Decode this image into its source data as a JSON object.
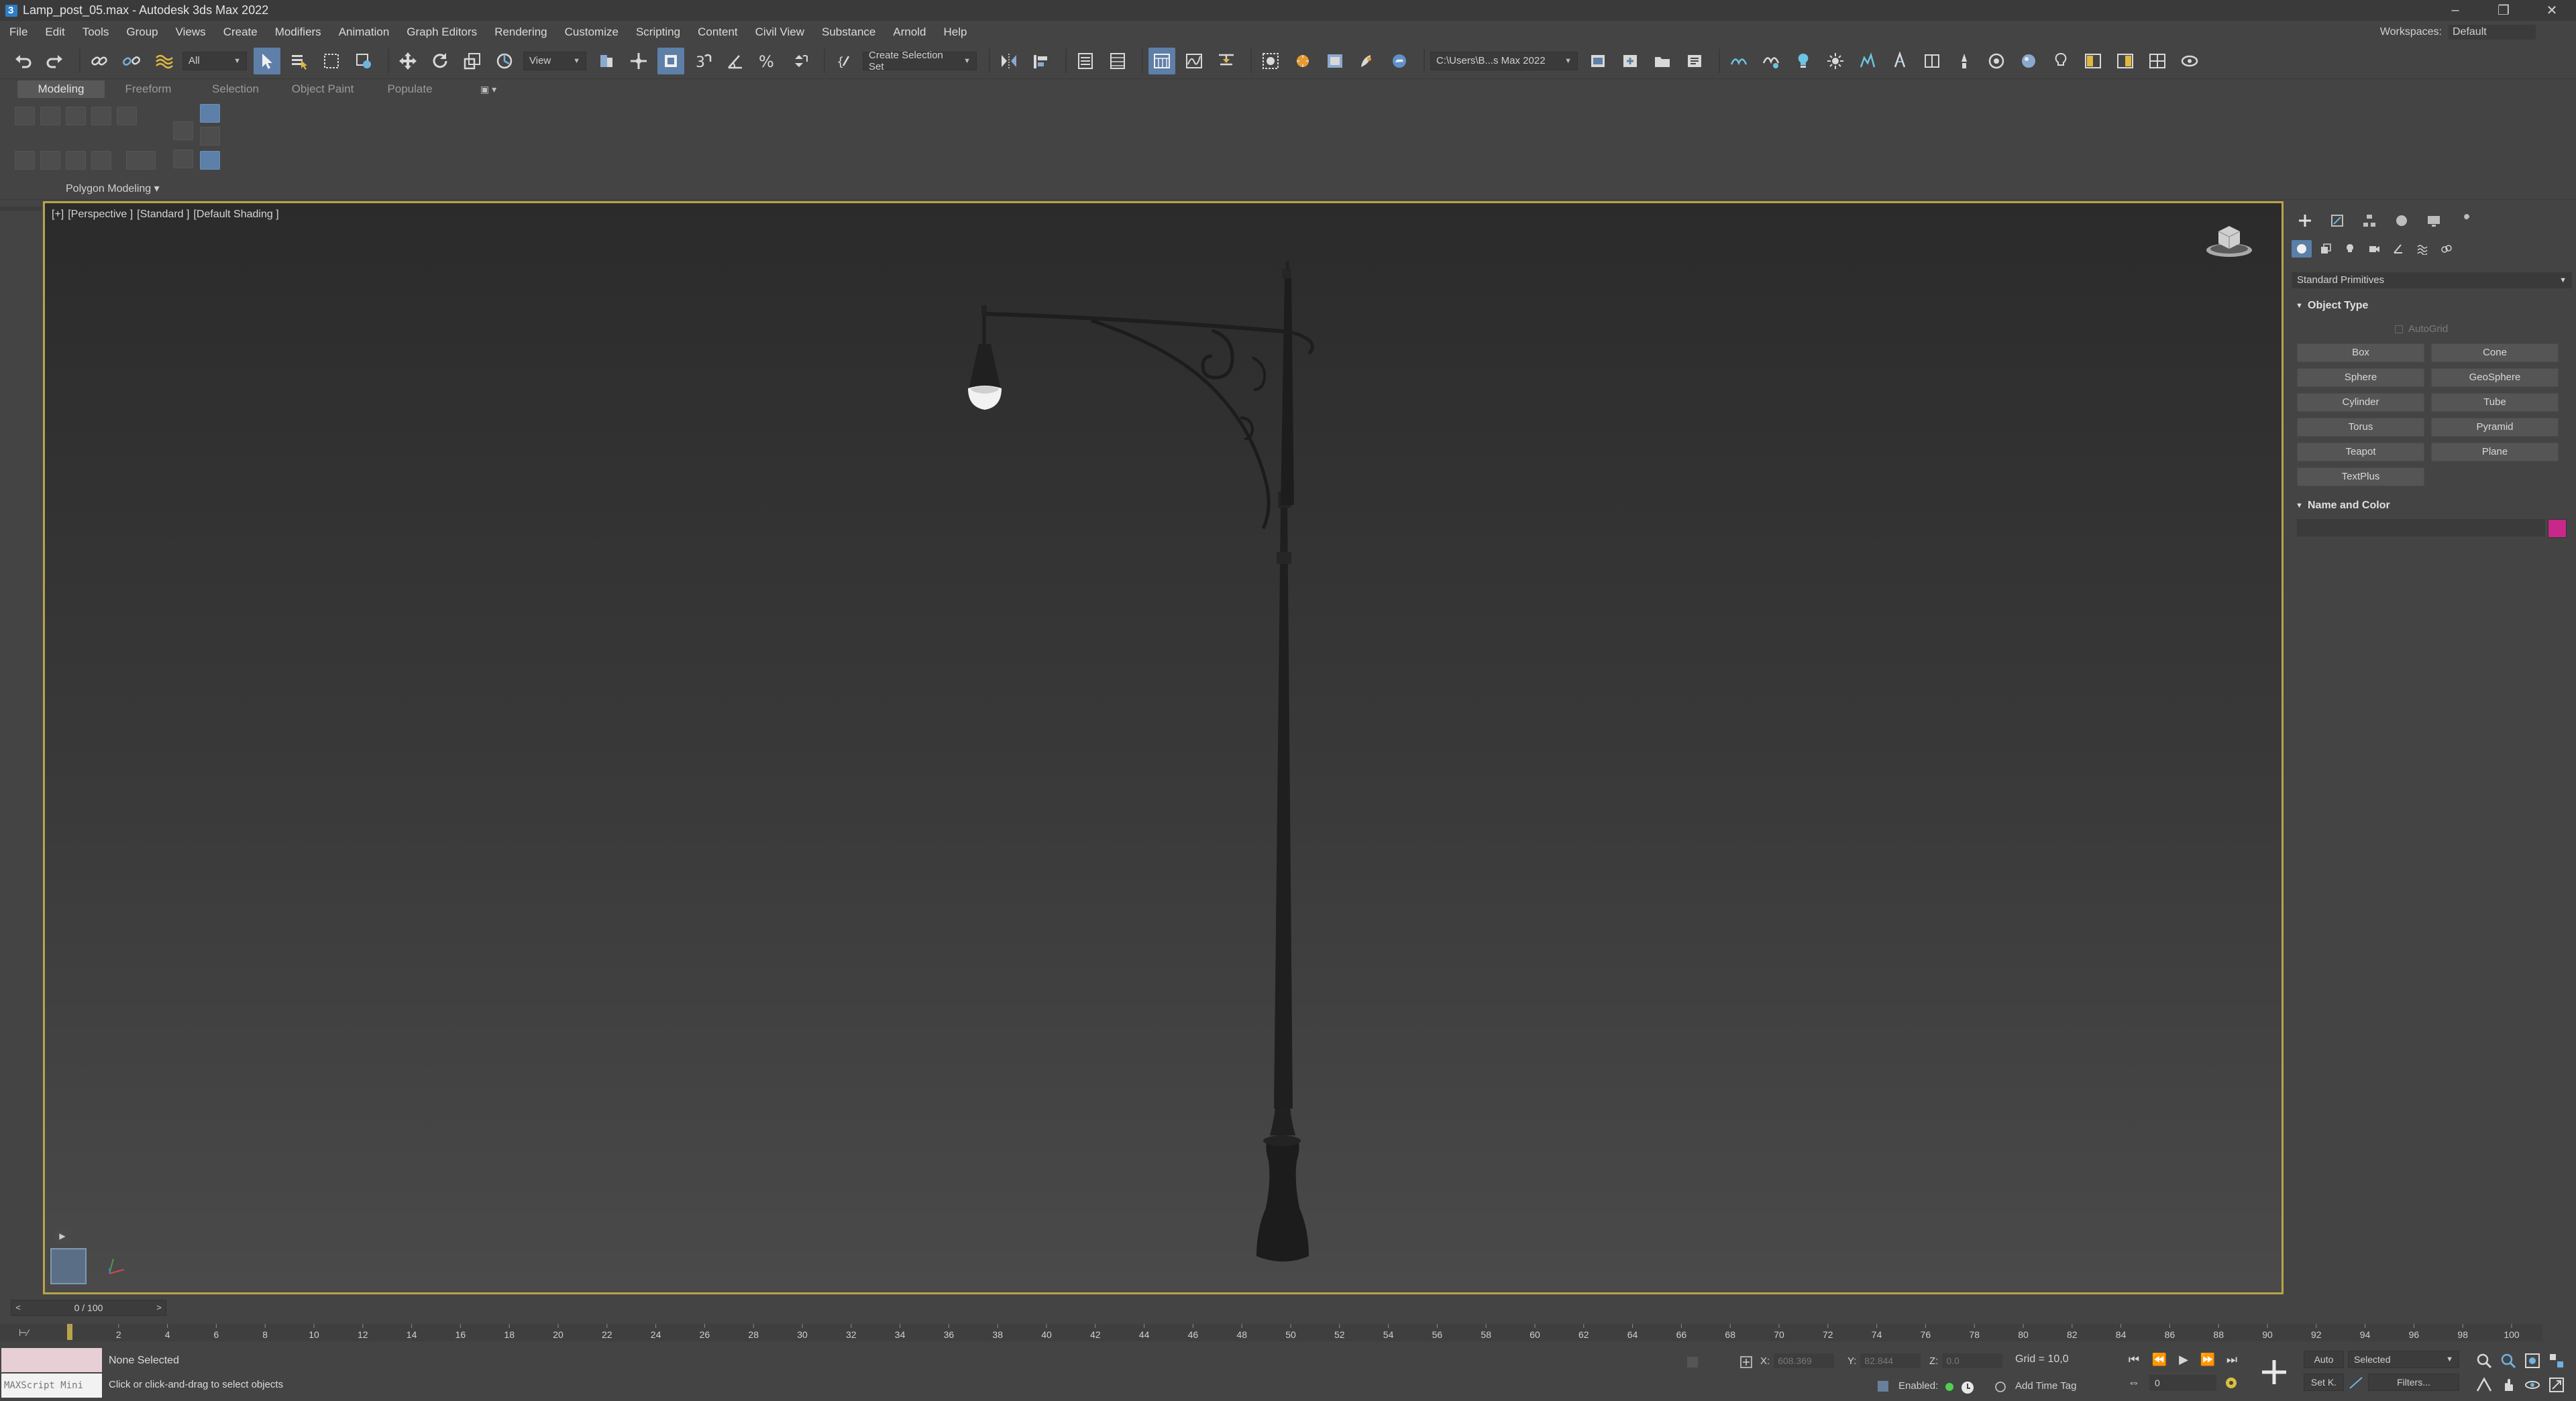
{
  "window": {
    "title": "Lamp_post_05.max - Autodesk 3ds Max 2022",
    "controls": [
      "–",
      "❐",
      "✕"
    ]
  },
  "menu": {
    "items": [
      "File",
      "Edit",
      "Tools",
      "Group",
      "Views",
      "Create",
      "Modifiers",
      "Animation",
      "Graph Editors",
      "Rendering",
      "Customize",
      "Scripting",
      "Content",
      "Civil View",
      "Substance",
      "Arnold",
      "Help"
    ],
    "workspaces_label": "Workspaces:",
    "workspaces_value": "Default"
  },
  "toolbar": {
    "filter_value": "All",
    "ref_coord_value": "View",
    "selection_set_placeholder": "Create Selection Set",
    "project_path": "C:\\Users\\B...s Max 2022"
  },
  "ribbon": {
    "tabs": [
      "Modeling",
      "Freeform",
      "Selection",
      "Object Paint",
      "Populate"
    ],
    "active_tab": "Modeling",
    "group_label": "Polygon Modeling"
  },
  "viewport": {
    "label_parts": [
      "[+]",
      "[Perspective ]",
      "[Standard ]",
      "[Default Shading ]"
    ]
  },
  "command_panel": {
    "category": "Standard Primitives",
    "object_type_title": "Object Type",
    "autogrid_label": "AutoGrid",
    "primitives": [
      "Box",
      "Cone",
      "Sphere",
      "GeoSphere",
      "Cylinder",
      "Tube",
      "Torus",
      "Pyramid",
      "Teapot",
      "Plane",
      "TextPlus"
    ],
    "name_color_title": "Name and Color",
    "object_color": "#c8288a"
  },
  "timeline": {
    "frame_readout": "0 / 100",
    "ticks": [
      "0",
      "2",
      "4",
      "6",
      "8",
      "10",
      "12",
      "14",
      "16",
      "18",
      "20",
      "22",
      "24",
      "26",
      "28",
      "30",
      "32",
      "34",
      "36",
      "38",
      "40",
      "42",
      "44",
      "46",
      "48",
      "50",
      "52",
      "54",
      "56",
      "58",
      "60",
      "62",
      "64",
      "66",
      "68",
      "70",
      "72",
      "74",
      "76",
      "78",
      "80",
      "82",
      "84",
      "86",
      "88",
      "90",
      "92",
      "94",
      "96",
      "98",
      "100"
    ]
  },
  "status": {
    "maxscript_label": "MAXScript Mini",
    "selection_msg": "None Selected",
    "prompt_msg": "Click or click-and-drag to select objects",
    "x_label": "X:",
    "x_value": "608.369",
    "y_label": "Y:",
    "y_value": "82.844",
    "z_label": "Z:",
    "z_value": "0.0",
    "grid": "Grid = 10,0",
    "enabled_label": "Enabled:",
    "add_time_tag": "Add Time Tag",
    "auto_key": "Auto",
    "key_filter_value": "Selected",
    "set_key": "Set K.",
    "filters": "Filters...",
    "current_frame": "0"
  },
  "colors": {
    "viewport_border": "#b9a448",
    "active_blue": "#5e7fa8"
  }
}
